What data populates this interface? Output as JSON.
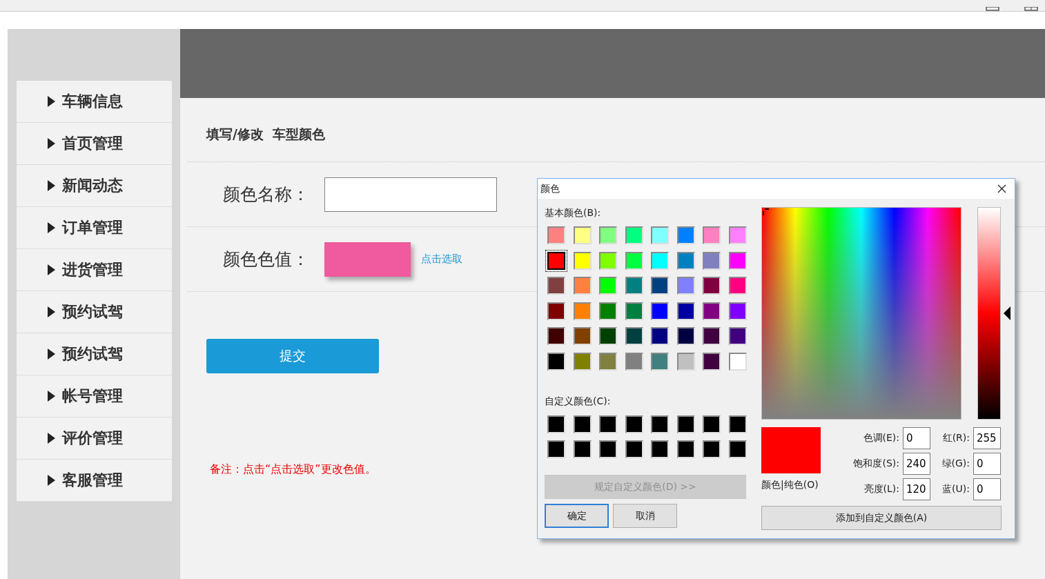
{
  "sidebar": {
    "items": [
      {
        "label": "车辆信息"
      },
      {
        "label": "首页管理"
      },
      {
        "label": "新闻动态"
      },
      {
        "label": "订单管理"
      },
      {
        "label": "进货管理"
      },
      {
        "label": "预约试驾"
      },
      {
        "label": "预约试驾"
      },
      {
        "label": "帐号管理"
      },
      {
        "label": "评价管理"
      },
      {
        "label": "客服管理"
      }
    ]
  },
  "form": {
    "title": "填写/修改  车型颜色",
    "fields": [
      {
        "kind": "text",
        "label": "颜色名称："
      },
      {
        "kind": "color",
        "label": "颜色色值：",
        "color": "#f05a9e",
        "link": "点击选取"
      }
    ],
    "submit": "提交",
    "note": "备注：点击“点击选取”更改色值。"
  },
  "dialog": {
    "title": "颜色",
    "basic_label": "基本颜色(B):",
    "basic_colors": [
      {
        "color": "#ff8080",
        "selected": false
      },
      {
        "color": "#ffff80",
        "selected": false
      },
      {
        "color": "#80ff80",
        "selected": false
      },
      {
        "color": "#00ff80",
        "selected": false
      },
      {
        "color": "#80ffff",
        "selected": false
      },
      {
        "color": "#0080ff",
        "selected": false
      },
      {
        "color": "#ff80c0",
        "selected": false
      },
      {
        "color": "#ff80ff",
        "selected": false
      },
      {
        "color": "#ff0000",
        "selected": true
      },
      {
        "color": "#ffff00",
        "selected": false
      },
      {
        "color": "#80ff00",
        "selected": false
      },
      {
        "color": "#00ff40",
        "selected": false
      },
      {
        "color": "#00ffff",
        "selected": false
      },
      {
        "color": "#0080c0",
        "selected": false
      },
      {
        "color": "#8080c0",
        "selected": false
      },
      {
        "color": "#ff00ff",
        "selected": false
      },
      {
        "color": "#804040",
        "selected": false
      },
      {
        "color": "#ff8040",
        "selected": false
      },
      {
        "color": "#00ff00",
        "selected": false
      },
      {
        "color": "#008080",
        "selected": false
      },
      {
        "color": "#004080",
        "selected": false
      },
      {
        "color": "#8080ff",
        "selected": false
      },
      {
        "color": "#800040",
        "selected": false
      },
      {
        "color": "#ff0080",
        "selected": false
      },
      {
        "color": "#800000",
        "selected": false
      },
      {
        "color": "#ff8000",
        "selected": false
      },
      {
        "color": "#008000",
        "selected": false
      },
      {
        "color": "#008040",
        "selected": false
      },
      {
        "color": "#0000ff",
        "selected": false
      },
      {
        "color": "#0000a0",
        "selected": false
      },
      {
        "color": "#800080",
        "selected": false
      },
      {
        "color": "#8000ff",
        "selected": false
      },
      {
        "color": "#400000",
        "selected": false
      },
      {
        "color": "#804000",
        "selected": false
      },
      {
        "color": "#004000",
        "selected": false
      },
      {
        "color": "#004040",
        "selected": false
      },
      {
        "color": "#000080",
        "selected": false
      },
      {
        "color": "#000040",
        "selected": false
      },
      {
        "color": "#400040",
        "selected": false
      },
      {
        "color": "#400080",
        "selected": false
      },
      {
        "color": "#000000",
        "selected": false
      },
      {
        "color": "#808000",
        "selected": false
      },
      {
        "color": "#808040",
        "selected": false
      },
      {
        "color": "#808080",
        "selected": false
      },
      {
        "color": "#408080",
        "selected": false
      },
      {
        "color": "#c0c0c0",
        "selected": false
      },
      {
        "color": "#400040",
        "selected": false
      },
      {
        "color": "#ffffff",
        "selected": false
      }
    ],
    "custom_label": "自定义颜色(C):",
    "custom_colors": [
      {
        "color": "#000000"
      },
      {
        "color": "#000000"
      },
      {
        "color": "#000000"
      },
      {
        "color": "#000000"
      },
      {
        "color": "#000000"
      },
      {
        "color": "#000000"
      },
      {
        "color": "#000000"
      },
      {
        "color": "#000000"
      },
      {
        "color": "#000000"
      },
      {
        "color": "#000000"
      },
      {
        "color": "#000000"
      },
      {
        "color": "#000000"
      },
      {
        "color": "#000000"
      },
      {
        "color": "#000000"
      },
      {
        "color": "#000000"
      },
      {
        "color": "#000000"
      }
    ],
    "define_button": {
      "label": "规定自定义颜色(D) >>",
      "disabled": true
    },
    "ok": "确定",
    "cancel": "取消",
    "luminance": {
      "level": 0.5
    },
    "preview": {
      "color": "#ff0000",
      "label": "颜色|纯色(O)"
    },
    "hsl": [
      {
        "label": "色调(E):",
        "value": "0"
      },
      {
        "label": "饱和度(S):",
        "value": "240"
      },
      {
        "label": "亮度(L):",
        "value": "120"
      }
    ],
    "rgb": [
      {
        "label": "红(R):",
        "value": "255"
      },
      {
        "label": "绿(G):",
        "value": "0"
      },
      {
        "label": "蓝(U):",
        "value": "0"
      }
    ],
    "add_button": "添加到自定义颜色(A)"
  }
}
